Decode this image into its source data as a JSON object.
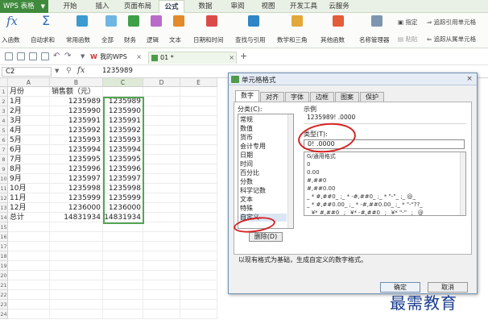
{
  "app": {
    "name": "WPS 表格"
  },
  "ribbon_tabs": [
    "开始",
    "插入",
    "页面布局",
    "公式",
    "数据",
    "审阅",
    "视图",
    "开发工具",
    "云服务"
  ],
  "ribbon_buttons": [
    "入函数",
    "自动求和",
    "常用函数",
    "全部",
    "财务",
    "逻辑",
    "文本",
    "日期和时间",
    "查找与引用",
    "数学和三角",
    "其他函数",
    "名称管理器"
  ],
  "ribbon_small": {
    "specify": "指定",
    "paste": "粘贴",
    "trace_precedents": "追踪引用单元格",
    "trace_dependents": "追踪从属单元格"
  },
  "doc_tabs": {
    "home": "我的WPS",
    "file": "01 *"
  },
  "formula_bar": {
    "name_box": "C2",
    "fx": "fx",
    "value": "1235989"
  },
  "grid": {
    "columns": [
      "A",
      "B",
      "C",
      "D",
      "E"
    ],
    "row_numbers": [
      "1",
      "2",
      "3",
      "4",
      "5",
      "6",
      "7",
      "8",
      "9",
      "10",
      "11",
      "12",
      "13",
      "14",
      "15",
      "16",
      "17",
      "18",
      "19",
      "20",
      "21",
      "22",
      "23",
      "24"
    ],
    "header": {
      "a": "月份",
      "b": "销售额（元）"
    },
    "rows": [
      {
        "a": "1月",
        "b": "1235989",
        "c": "1235989"
      },
      {
        "a": "2月",
        "b": "1235990",
        "c": "1235990"
      },
      {
        "a": "3月",
        "b": "1235991",
        "c": "1235991"
      },
      {
        "a": "4月",
        "b": "1235992",
        "c": "1235992"
      },
      {
        "a": "5月",
        "b": "1235993",
        "c": "1235993"
      },
      {
        "a": "6月",
        "b": "1235994",
        "c": "1235994"
      },
      {
        "a": "7月",
        "b": "1235995",
        "c": "1235995"
      },
      {
        "a": "8月",
        "b": "1235996",
        "c": "1235996"
      },
      {
        "a": "9月",
        "b": "1235997",
        "c": "1235997"
      },
      {
        "a": "10月",
        "b": "1235998",
        "c": "1235998"
      },
      {
        "a": "11月",
        "b": "1235999",
        "c": "1235999"
      },
      {
        "a": "12月",
        "b": "1236000",
        "c": "1236000"
      },
      {
        "a": "总计",
        "b": "14831934",
        "c": "14831934"
      }
    ]
  },
  "dialog": {
    "title": "单元格格式",
    "close": "×",
    "tabs": [
      "数字",
      "对齐",
      "字体",
      "边框",
      "图案",
      "保护"
    ],
    "category_label": "分类(C):",
    "categories": [
      "常规",
      "数值",
      "货币",
      "会计专用",
      "日期",
      "时间",
      "百分比",
      "分数",
      "科学记数",
      "文本",
      "特殊",
      "自定义"
    ],
    "selected_category": "自定义",
    "sample_label": "示例",
    "sample_value": "1235989! .0000",
    "type_label": "类型(T):",
    "type_value": "0! .0000",
    "format_list": [
      "G/通用格式",
      "0",
      "0.00",
      "#,##0",
      "#,##0.00",
      "_ * #,##0_ ;_ * -#,##0_ ;_ * \"-\"_ ;_ @_",
      "_ * #,##0.00_ ;_ * -#,##0.00_ ;_ * \"-\"??_",
      "_ ¥* #,##0_ ;_ ¥* -#,##0_ ;_ ¥* \"-\"_ ;_ @"
    ],
    "delete_label": "删除(D)",
    "hint": "以现有格式为基础，生成自定义的数字格式。",
    "ok_label": "确定",
    "cancel_label": "取消"
  },
  "watermark": "最需教育",
  "colors": {
    "accent_green": "#3f8a3c",
    "selection_green": "#53a553",
    "annotation_red": "#d62323"
  }
}
